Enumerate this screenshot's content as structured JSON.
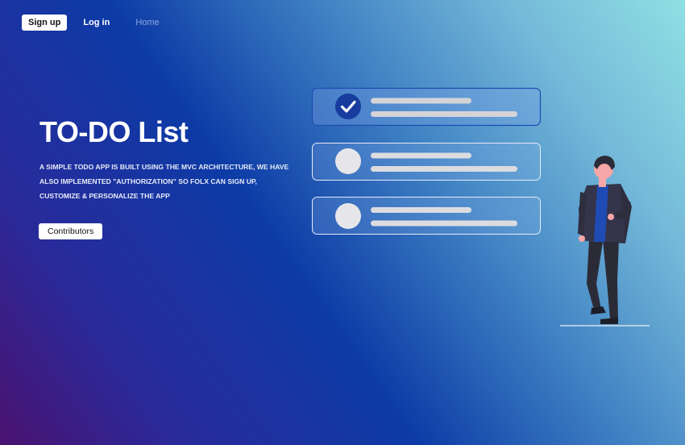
{
  "nav": {
    "signup_label": "Sign up",
    "login_label": "Log in",
    "home_label": "Home"
  },
  "hero": {
    "title": "TO-DO List",
    "description": "A SIMPLE TODO APP IS BUILT USING THE MVC ARCHITECTURE, WE HAVE ALSO IMPLEMENTED \"AUTHORIZATION\" SO FOLX CAN SIGN UP, CUSTOMIZE & PERSONALIZE THE APP",
    "contributors_label": "Contributors"
  },
  "illustration": {
    "icons": [
      "checkmark-icon",
      "person-icon"
    ],
    "task_cards": [
      {
        "checked": true
      },
      {
        "checked": false
      },
      {
        "checked": false
      }
    ]
  },
  "colors": {
    "check_accent": "#173c9e",
    "person_shirt": "#1f4bb5",
    "person_jacket": "#2e2e3e",
    "skin": "#f6a7a7"
  }
}
